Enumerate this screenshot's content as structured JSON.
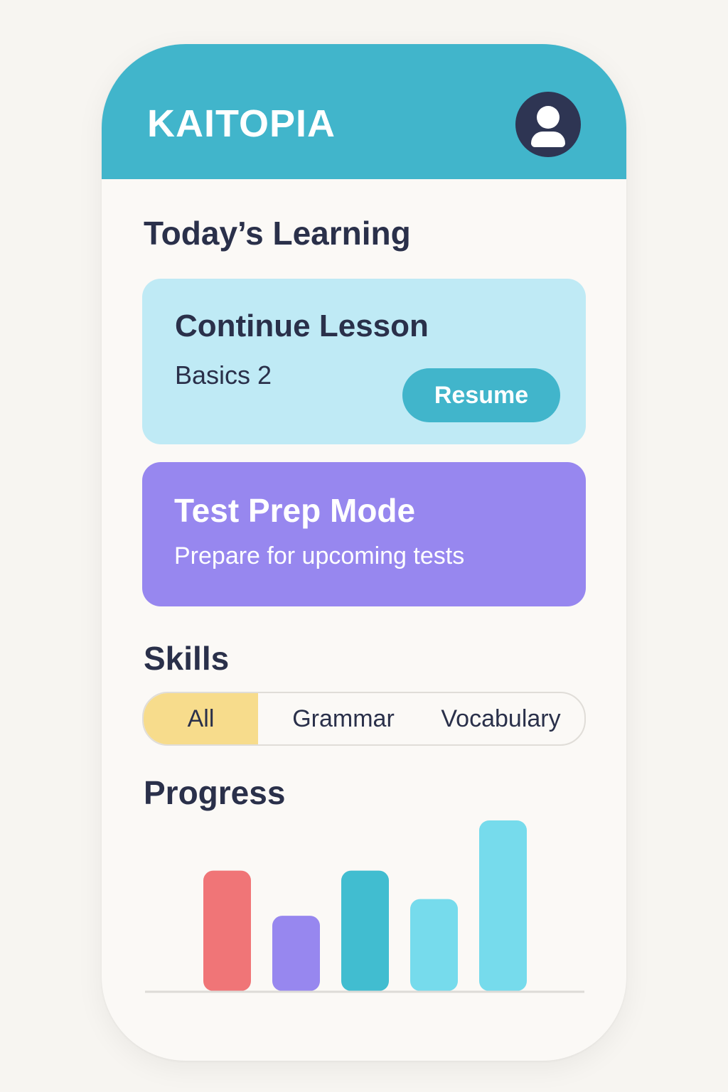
{
  "app": {
    "title": "KAITOPIA"
  },
  "header": {
    "avatar_icon": "user-icon"
  },
  "today": {
    "heading": "Today’s Learning",
    "lesson_card": {
      "title": "Continue Lesson",
      "subtitle": "Basics 2",
      "button_label": "Resume"
    },
    "test_prep_card": {
      "title": "Test Prep Mode",
      "subtitle": "Prepare for upcoming tests"
    }
  },
  "skills": {
    "heading": "Skills",
    "tabs": [
      {
        "label": "All",
        "selected": true
      },
      {
        "label": "Grammar",
        "selected": false
      },
      {
        "label": "Vocabulary",
        "selected": false
      }
    ]
  },
  "progress": {
    "heading": "Progress"
  },
  "colors": {
    "accent": "#41b5cb",
    "dark": "#2e3553",
    "lesson_bg": "#bfeaf5",
    "test_prep_bg": "#9787ef",
    "selected_tab": "#f7dc8c"
  },
  "chart_data": {
    "type": "bar",
    "categories": [
      "",
      "",
      "",
      "",
      ""
    ],
    "values": [
      72,
      45,
      72,
      55,
      102
    ],
    "colors": [
      "#f07577",
      "#9787ef",
      "#41bdd0",
      "#76dbec",
      "#76dbec"
    ],
    "ylim": [
      0,
      102
    ],
    "grid": false,
    "title": "",
    "xlabel": "",
    "ylabel": ""
  }
}
